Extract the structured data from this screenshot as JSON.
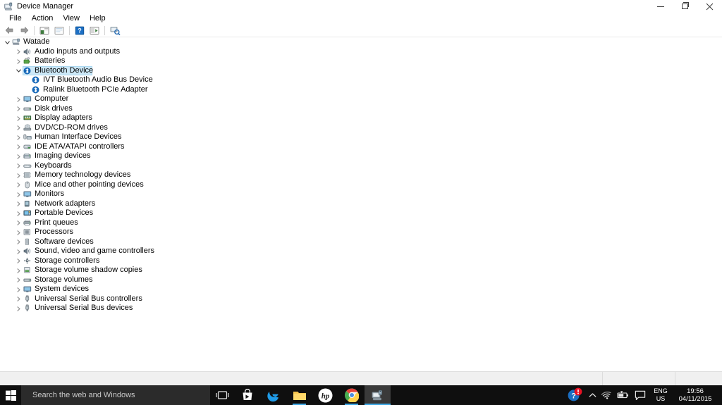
{
  "window": {
    "title": "Device Manager",
    "title_icon": "device-manager-icon",
    "caption": {
      "minimize": "Minimize",
      "maximize": "Restore Down",
      "close": "Close"
    }
  },
  "menubar": {
    "items": [
      {
        "label": "File"
      },
      {
        "label": "Action"
      },
      {
        "label": "View"
      },
      {
        "label": "Help"
      }
    ]
  },
  "toolbar": {
    "buttons": [
      {
        "name": "back-arrow-icon",
        "tooltip": "Back"
      },
      {
        "name": "forward-arrow-icon",
        "tooltip": "Forward"
      },
      {
        "name": "separator"
      },
      {
        "name": "show-hide-console-tree-icon",
        "tooltip": "Show/Hide Console Tree"
      },
      {
        "name": "properties-icon",
        "tooltip": "Properties"
      },
      {
        "name": "separator"
      },
      {
        "name": "help-icon",
        "tooltip": "Help"
      },
      {
        "name": "update-driver-icon",
        "tooltip": "Update Driver Software"
      },
      {
        "name": "separator"
      },
      {
        "name": "scan-for-hardware-changes-icon",
        "tooltip": "Scan for hardware changes"
      }
    ]
  },
  "tree": {
    "root": {
      "label": "Watade",
      "icon": "computer-root-icon",
      "expanded": true,
      "selected": false
    },
    "nodes": [
      {
        "label": "Audio inputs and outputs",
        "icon": "speaker-icon",
        "expanded": false,
        "selected": false,
        "depth": 1
      },
      {
        "label": "Batteries",
        "icon": "battery-icon",
        "expanded": false,
        "selected": false,
        "depth": 1
      },
      {
        "label": "Bluetooth Device",
        "icon": "bluetooth-icon",
        "expanded": true,
        "selected": true,
        "depth": 1
      },
      {
        "label": "IVT Bluetooth Audio Bus Device",
        "icon": "bluetooth-icon",
        "leaf": true,
        "selected": false,
        "depth": 2
      },
      {
        "label": "Ralink Bluetooth PCIe Adapter",
        "icon": "bluetooth-icon",
        "leaf": true,
        "selected": false,
        "depth": 2
      },
      {
        "label": "Computer",
        "icon": "monitor-icon",
        "expanded": false,
        "selected": false,
        "depth": 1
      },
      {
        "label": "Disk drives",
        "icon": "disk-drive-icon",
        "expanded": false,
        "selected": false,
        "depth": 1
      },
      {
        "label": "Display adapters",
        "icon": "display-adapter-icon",
        "expanded": false,
        "selected": false,
        "depth": 1
      },
      {
        "label": "DVD/CD-ROM drives",
        "icon": "dvd-drive-icon",
        "expanded": false,
        "selected": false,
        "depth": 1
      },
      {
        "label": "Human Interface Devices",
        "icon": "hid-icon",
        "expanded": false,
        "selected": false,
        "depth": 1
      },
      {
        "label": "IDE ATA/ATAPI controllers",
        "icon": "ide-controller-icon",
        "expanded": false,
        "selected": false,
        "depth": 1
      },
      {
        "label": "Imaging devices",
        "icon": "imaging-device-icon",
        "expanded": false,
        "selected": false,
        "depth": 1
      },
      {
        "label": "Keyboards",
        "icon": "keyboard-icon",
        "expanded": false,
        "selected": false,
        "depth": 1
      },
      {
        "label": "Memory technology devices",
        "icon": "memory-device-icon",
        "expanded": false,
        "selected": false,
        "depth": 1
      },
      {
        "label": "Mice and other pointing devices",
        "icon": "mouse-icon",
        "expanded": false,
        "selected": false,
        "depth": 1
      },
      {
        "label": "Monitors",
        "icon": "monitor-icon",
        "expanded": false,
        "selected": false,
        "depth": 1
      },
      {
        "label": "Network adapters",
        "icon": "network-adapter-icon",
        "expanded": false,
        "selected": false,
        "depth": 1
      },
      {
        "label": "Portable Devices",
        "icon": "portable-device-icon",
        "expanded": false,
        "selected": false,
        "depth": 1
      },
      {
        "label": "Print queues",
        "icon": "printer-icon",
        "expanded": false,
        "selected": false,
        "depth": 1
      },
      {
        "label": "Processors",
        "icon": "processor-icon",
        "expanded": false,
        "selected": false,
        "depth": 1
      },
      {
        "label": "Software devices",
        "icon": "software-device-icon",
        "expanded": false,
        "selected": false,
        "depth": 1
      },
      {
        "label": "Sound, video and game controllers",
        "icon": "speaker-icon",
        "expanded": false,
        "selected": false,
        "depth": 1
      },
      {
        "label": "Storage controllers",
        "icon": "storage-controller-icon",
        "expanded": false,
        "selected": false,
        "depth": 1
      },
      {
        "label": "Storage volume shadow copies",
        "icon": "shadow-copy-icon",
        "expanded": false,
        "selected": false,
        "depth": 1
      },
      {
        "label": "Storage volumes",
        "icon": "storage-volume-icon",
        "expanded": false,
        "selected": false,
        "depth": 1
      },
      {
        "label": "System devices",
        "icon": "system-device-icon",
        "expanded": false,
        "selected": false,
        "depth": 1
      },
      {
        "label": "Universal Serial Bus controllers",
        "icon": "usb-icon",
        "expanded": false,
        "selected": false,
        "depth": 1
      },
      {
        "label": "Universal Serial Bus devices",
        "icon": "usb-icon",
        "expanded": false,
        "selected": false,
        "depth": 1
      }
    ]
  },
  "statusbar": {
    "pane1": "",
    "pane2": "",
    "pane3": ""
  },
  "taskbar": {
    "start_button": "start-button",
    "search": {
      "placeholder": "Search the web and Windows",
      "value": ""
    },
    "task_view": "task-view-button",
    "apps": [
      {
        "name": "store-icon",
        "label": "Store",
        "active": false
      },
      {
        "name": "edge-icon",
        "label": "Microsoft Edge",
        "active": false
      },
      {
        "name": "file-explorer-icon",
        "label": "File Explorer",
        "active": false
      },
      {
        "name": "hp-icon",
        "label": "HP",
        "active": false
      },
      {
        "name": "chrome-icon",
        "label": "Google Chrome",
        "active": false
      },
      {
        "name": "device-manager-taskbar-icon",
        "label": "Device Manager",
        "active": true
      }
    ],
    "tray": {
      "action_alert_icon": "help-alert-icon",
      "chevron_icon": "show-hidden-icons-chevron",
      "network_icon": "wifi-icon",
      "battery_icon": "battery-tray-icon",
      "notifications_icon": "action-center-icon",
      "language_line1": "ENG",
      "language_line2": "US",
      "time": "19:56",
      "date": "04/11/2015"
    }
  },
  "colors": {
    "selection_fill": "#cce8f7",
    "selection_border": "#a9d6ef",
    "taskbar_bg": "#0f0f0f",
    "search_bg": "#2b2b2b",
    "accent_blue": "#3ea8e5",
    "window_bg": "#ffffff",
    "statusbar_bg": "#f0f0f0"
  }
}
